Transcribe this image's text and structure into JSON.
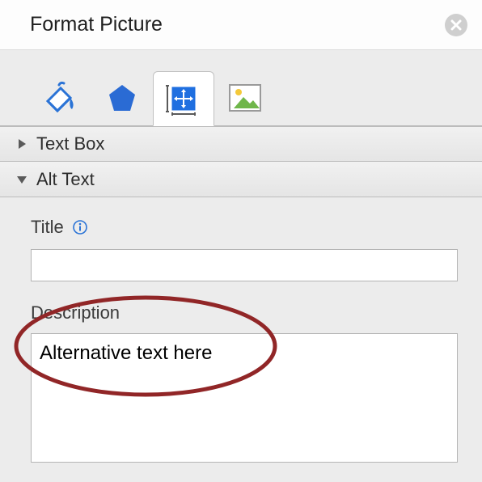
{
  "header": {
    "title": "Format Picture"
  },
  "tabs": {
    "fill_icon": "fill-bucket-icon",
    "shape_icon": "pentagon-icon",
    "size_icon": "size-properties-icon",
    "picture_icon": "picture-icon",
    "active": "size"
  },
  "sections": {
    "textbox": {
      "label": "Text Box",
      "expanded": false
    },
    "alttext": {
      "label": "Alt Text",
      "expanded": true
    }
  },
  "alttext": {
    "title_label": "Title",
    "title_value": "",
    "description_label": "Description",
    "description_value": "Alternative text here"
  }
}
